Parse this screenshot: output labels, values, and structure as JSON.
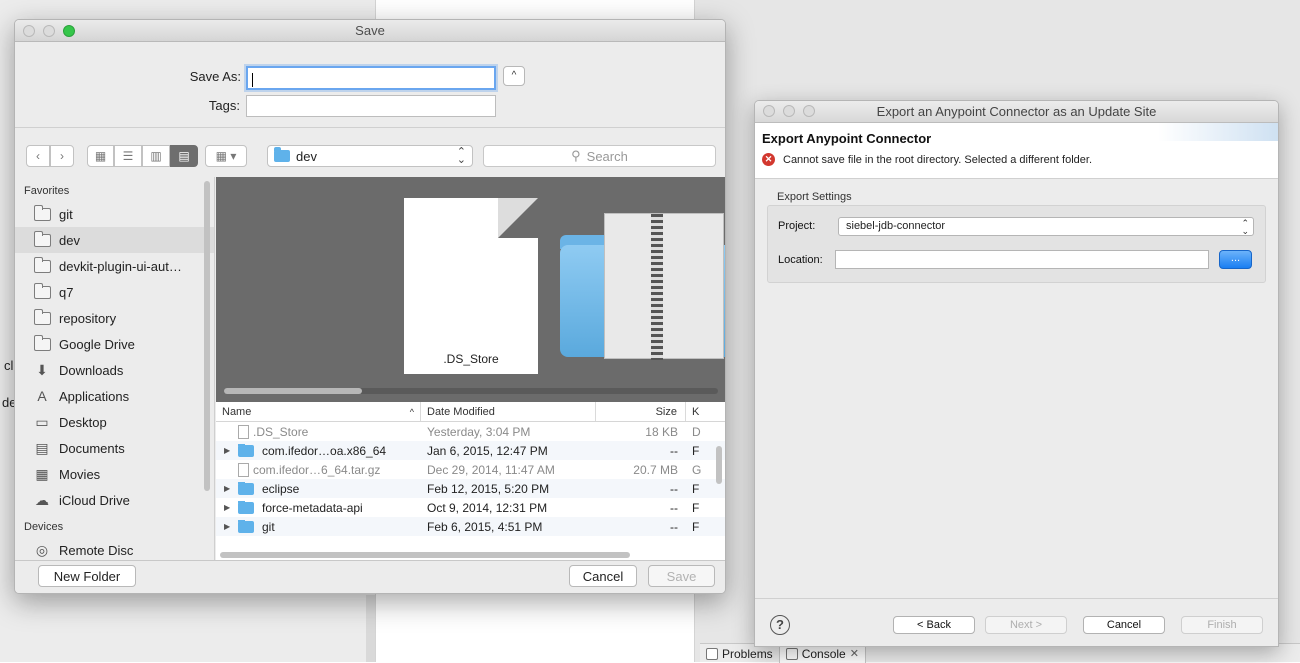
{
  "background": {
    "left_stubs": [
      "cl",
      "de"
    ],
    "tabs": [
      {
        "label": "Problems"
      },
      {
        "label": "Console",
        "close": "✕"
      }
    ]
  },
  "save_dialog": {
    "title": "Save",
    "save_as_label": "Save As:",
    "save_as_value": "",
    "tags_label": "Tags:",
    "tags_value": "",
    "expand_icon": "chevron-up-icon",
    "location": "dev",
    "search_placeholder": "Search",
    "sidebar": {
      "favorites_header": "Favorites",
      "favorites": [
        {
          "label": "git",
          "icon": "folder-icon"
        },
        {
          "label": "dev",
          "icon": "folder-icon",
          "selected": true
        },
        {
          "label": "devkit-plugin-ui-aut…",
          "icon": "folder-icon"
        },
        {
          "label": "q7",
          "icon": "folder-icon"
        },
        {
          "label": "repository",
          "icon": "folder-icon"
        },
        {
          "label": "Google Drive",
          "icon": "folder-icon"
        },
        {
          "label": "Downloads",
          "icon": "downloads-icon"
        },
        {
          "label": "Applications",
          "icon": "applications-icon"
        },
        {
          "label": "Desktop",
          "icon": "desktop-icon"
        },
        {
          "label": "Documents",
          "icon": "documents-icon"
        },
        {
          "label": "Movies",
          "icon": "movies-icon"
        },
        {
          "label": "iCloud Drive",
          "icon": "cloud-icon"
        }
      ],
      "devices_header": "Devices",
      "devices": [
        {
          "label": "Remote Disc"
        }
      ]
    },
    "coverflow_label": ".DS_Store",
    "columns": {
      "name": "Name",
      "date": "Date Modified",
      "size": "Size",
      "kind": "K"
    },
    "files": [
      {
        "name": ".DS_Store",
        "date": "Yesterday, 3:04 PM",
        "size": "18 KB",
        "kind": "D",
        "type": "file",
        "dim": true
      },
      {
        "name": "com.ifedor…oa.x86_64",
        "date": "Jan 6, 2015, 12:47 PM",
        "size": "--",
        "kind": "F",
        "type": "folder",
        "dim": false
      },
      {
        "name": "com.ifedor…6_64.tar.gz",
        "date": "Dec 29, 2014, 11:47 AM",
        "size": "20.7 MB",
        "kind": "G",
        "type": "file",
        "dim": true
      },
      {
        "name": "eclipse",
        "date": "Feb 12, 2015, 5:20 PM",
        "size": "--",
        "kind": "F",
        "type": "folder",
        "dim": false
      },
      {
        "name": "force-metadata-api",
        "date": "Oct 9, 2014, 12:31 PM",
        "size": "--",
        "kind": "F",
        "type": "folder",
        "dim": false
      },
      {
        "name": "git",
        "date": "Feb 6, 2015, 4:51 PM",
        "size": "--",
        "kind": "F",
        "type": "folder",
        "dim": false
      }
    ],
    "new_folder_label": "New Folder",
    "cancel_label": "Cancel",
    "save_label": "Save"
  },
  "export_dialog": {
    "title": "Export an Anypoint Connector as an Update  Site",
    "header": "Export Anypoint Connector",
    "error_message": "Cannot save file in the root directory. Selected a different folder.",
    "settings_group": "Export Settings",
    "project_label": "Project:",
    "project_value": "siebel-jdb-connector",
    "location_label": "Location:",
    "location_value": "",
    "browse_label": "...",
    "back_label": "< Back",
    "next_label": "Next >",
    "cancel_label": "Cancel",
    "finish_label": "Finish"
  }
}
